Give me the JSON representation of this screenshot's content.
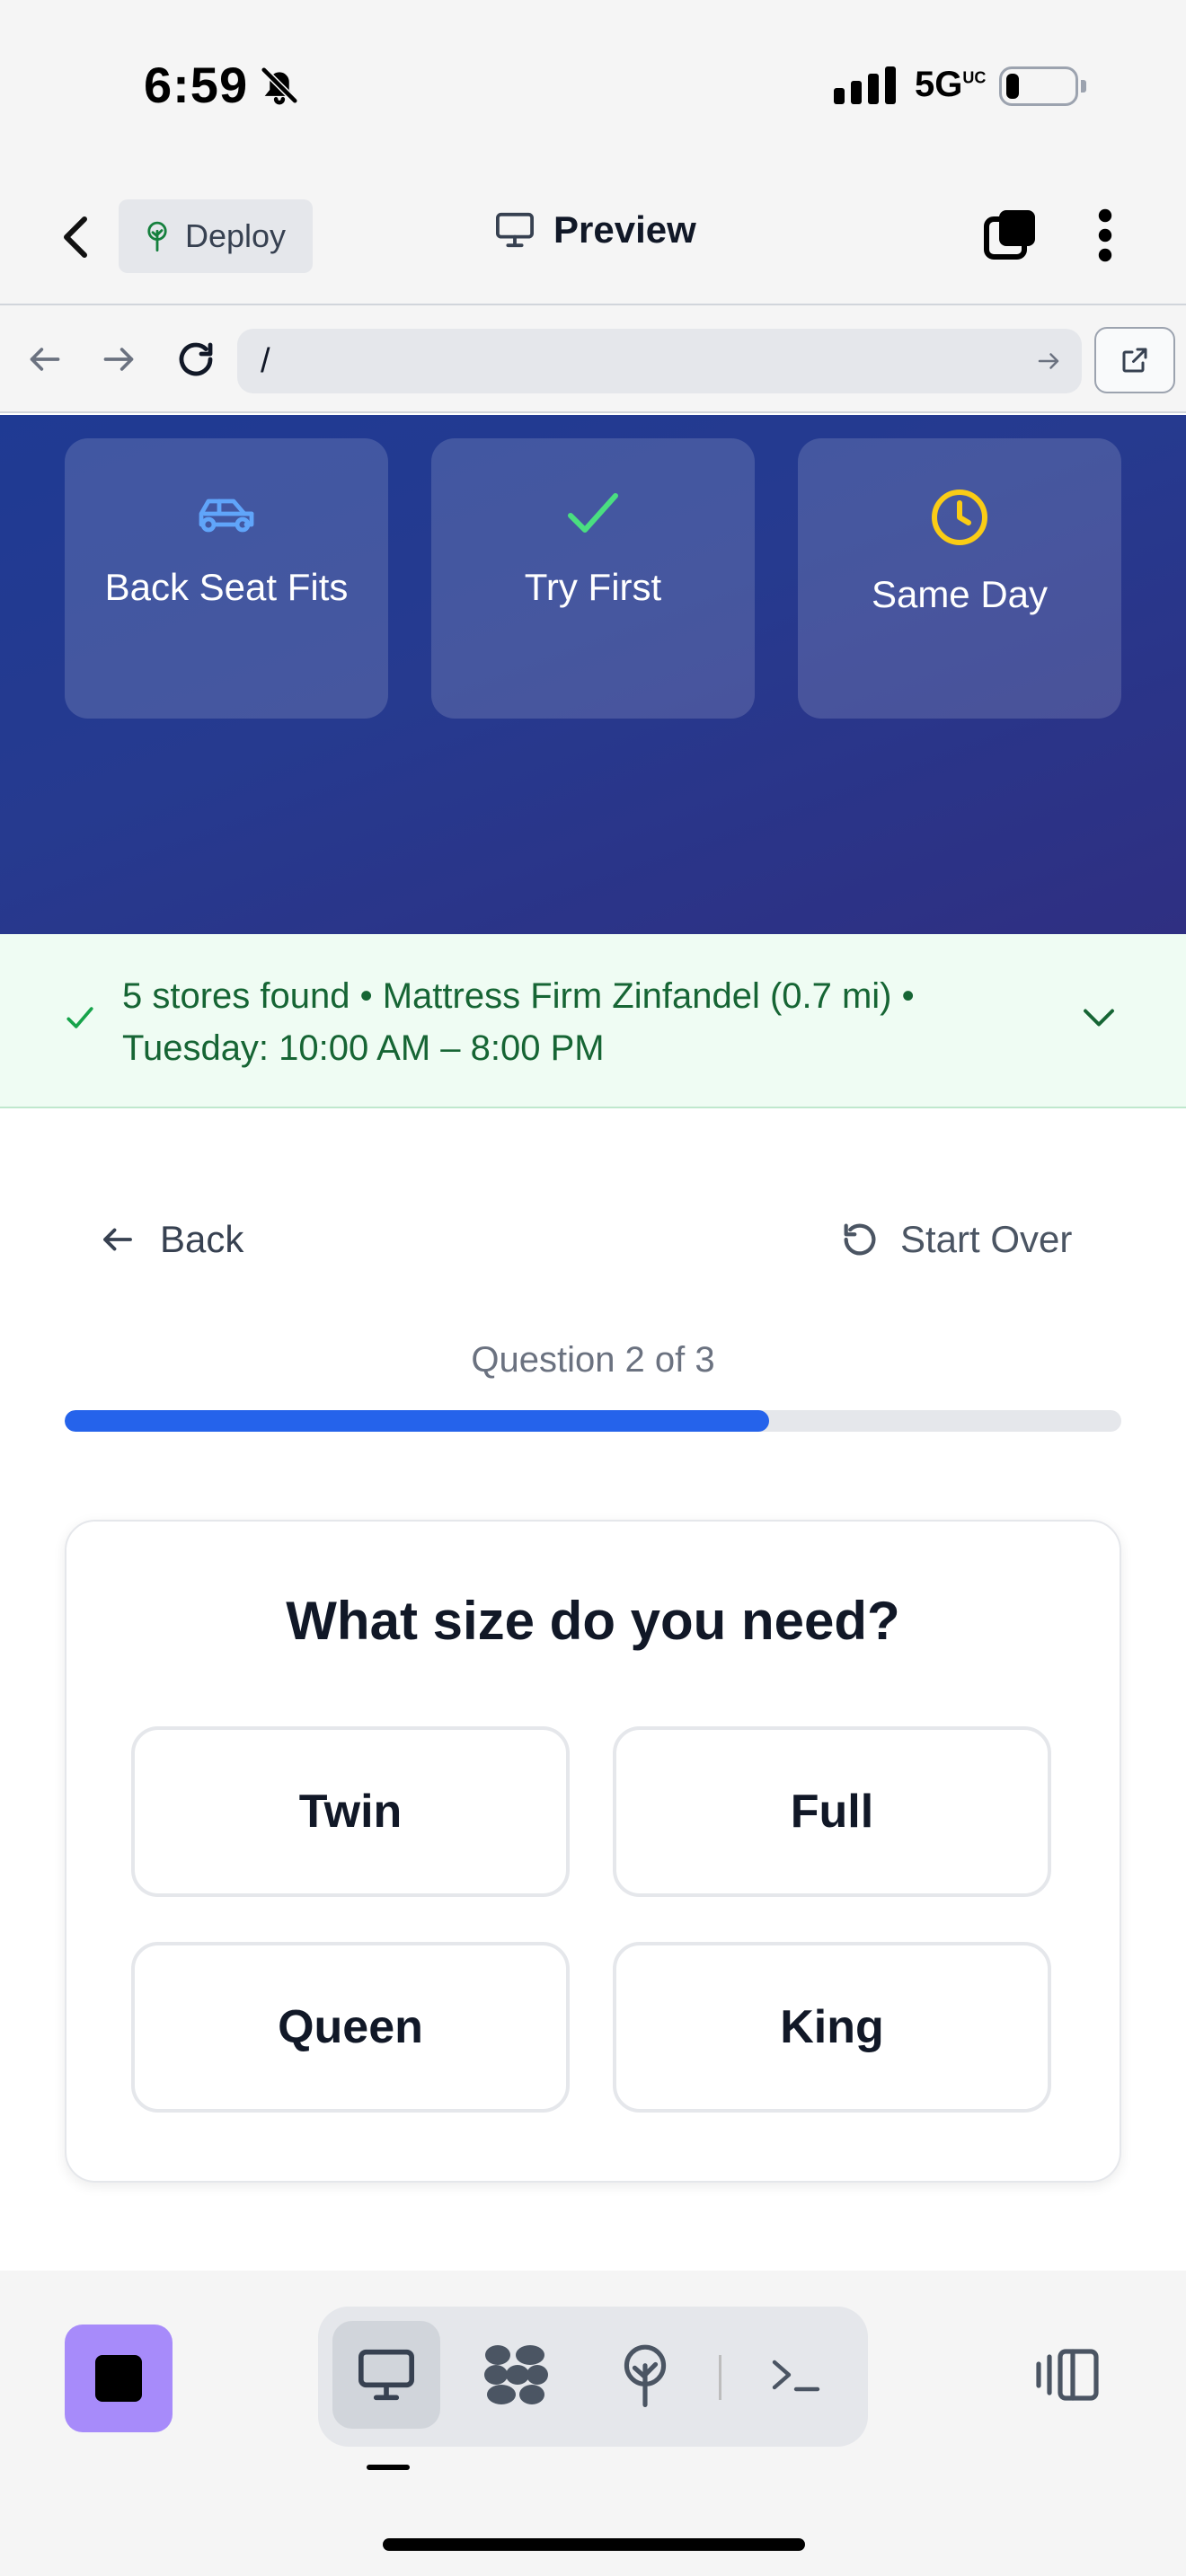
{
  "status_bar": {
    "time": "6:59",
    "network": "5G",
    "network_suffix": "UC"
  },
  "header": {
    "deploy_label": "Deploy",
    "title": "Preview"
  },
  "browser": {
    "url": "/"
  },
  "features": [
    {
      "label": "Back Seat Fits",
      "icon": "car-icon",
      "color": "#60a5fa"
    },
    {
      "label": "Try First",
      "icon": "check-icon",
      "color": "#4ade80"
    },
    {
      "label": "Same Day",
      "icon": "clock-icon",
      "color": "#facc15"
    }
  ],
  "store_banner": {
    "text": "5 stores found • Mattress Firm Zinfandel (0.7 mi) • Tuesday: 10:00 AM – 8:00 PM"
  },
  "quiz": {
    "back_label": "Back",
    "start_over_label": "Start Over",
    "progress_label": "Question 2 of 3",
    "progress_fraction": 0.667,
    "question": "What size do you need?",
    "options": [
      "Twin",
      "Full",
      "Queen",
      "King"
    ]
  },
  "colors": {
    "accent": "#2563eb",
    "hero_bg": "#263a8f",
    "banner_text": "#166534",
    "stop_button": "#a78bfa"
  }
}
